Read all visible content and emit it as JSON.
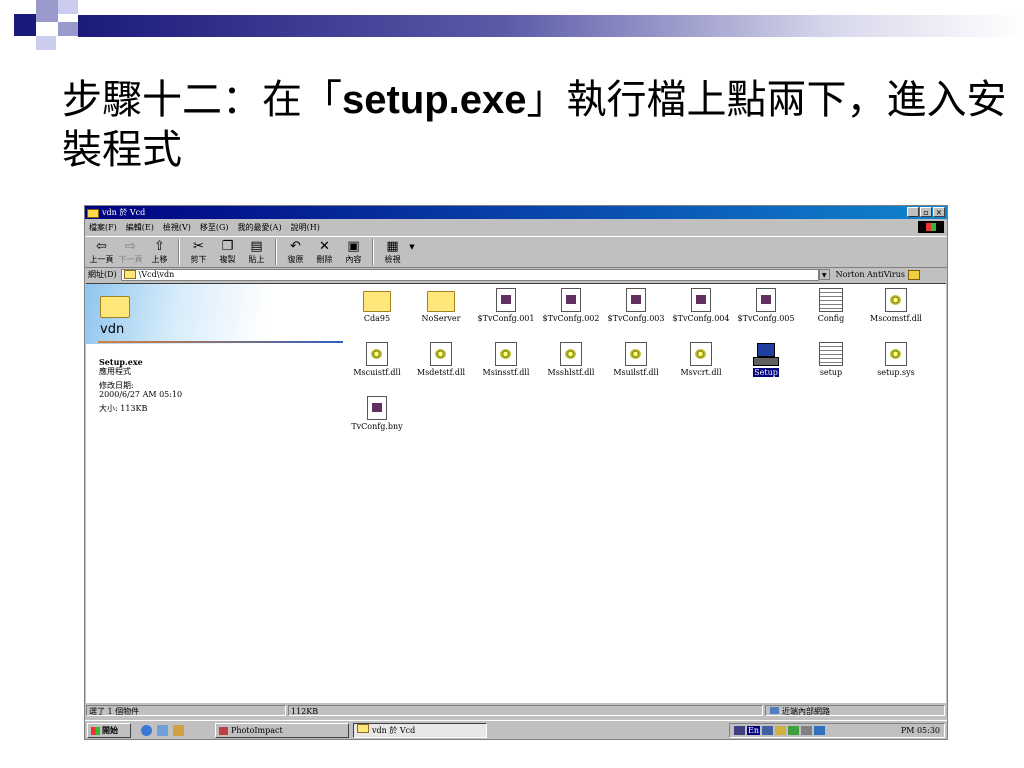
{
  "slide": {
    "title_pre": "步驟十二：在「",
    "title_bold": "setup.exe",
    "title_post": "」執行檔上點兩下，進入安裝程式",
    "colors": {
      "navy": "#1a1a7a",
      "lavender": "#9999cc"
    }
  },
  "window": {
    "title": "vdn 於 Vcd",
    "controls": {
      "minimize": "_",
      "maximize": "▫",
      "close": "×"
    },
    "menu": [
      "檔案(F)",
      "編輯(E)",
      "檢視(V)",
      "移至(G)",
      "我的最愛(A)",
      "說明(H)"
    ],
    "toolbar": {
      "back": "上一頁",
      "forward": "下一頁",
      "up": "上移",
      "cut": "剪下",
      "copy": "複製",
      "paste": "貼上",
      "undo": "復原",
      "delete": "刪除",
      "properties": "內容",
      "views": "檢視"
    },
    "address": {
      "label": "網址(D)",
      "value": "\\Vcd\\vdn",
      "norton": "Norton AntiVirus"
    },
    "webview": {
      "folder_name": "vdn",
      "selected_file": "Setup.exe",
      "file_type": "應用程式",
      "modified_label": "修改日期:",
      "modified_value": "2000/6/27 AM 05:10",
      "size": "大小: 113KB"
    },
    "files": [
      {
        "name": "Cda95",
        "type": "folder"
      },
      {
        "name": "NoServer",
        "type": "folder"
      },
      {
        "name": "$TvConfg.001",
        "type": "doc"
      },
      {
        "name": "$TvConfg.002",
        "type": "doc"
      },
      {
        "name": "$TvConfg.003",
        "type": "doc"
      },
      {
        "name": "$TvConfg.004",
        "type": "doc"
      },
      {
        "name": "$TvConfg.005",
        "type": "doc"
      },
      {
        "name": "Config",
        "type": "cfg"
      },
      {
        "name": "Mscomstf.dll",
        "type": "dll"
      },
      {
        "name": "Mscuistf.dll",
        "type": "dll"
      },
      {
        "name": "Msdetstf.dll",
        "type": "dll"
      },
      {
        "name": "Msinsstf.dll",
        "type": "dll"
      },
      {
        "name": "Msshlstf.dll",
        "type": "dll"
      },
      {
        "name": "Msuilstf.dll",
        "type": "dll"
      },
      {
        "name": "Msvcrt.dll",
        "type": "dll"
      },
      {
        "name": "Setup",
        "type": "setup",
        "selected": true
      },
      {
        "name": "setup",
        "type": "cfg"
      },
      {
        "name": "setup.sys",
        "type": "dll"
      },
      {
        "name": "TvConfg.bny",
        "type": "doc"
      }
    ],
    "status": {
      "objects": "選了 1 個物件",
      "size": "112KB",
      "zone": "近端內部網路"
    },
    "taskbar": {
      "start": "開始",
      "tasks": [
        "PhotoImpact",
        "vdn 於 Vcd"
      ],
      "tray_lang": "En",
      "clock": "PM 05:30"
    }
  }
}
